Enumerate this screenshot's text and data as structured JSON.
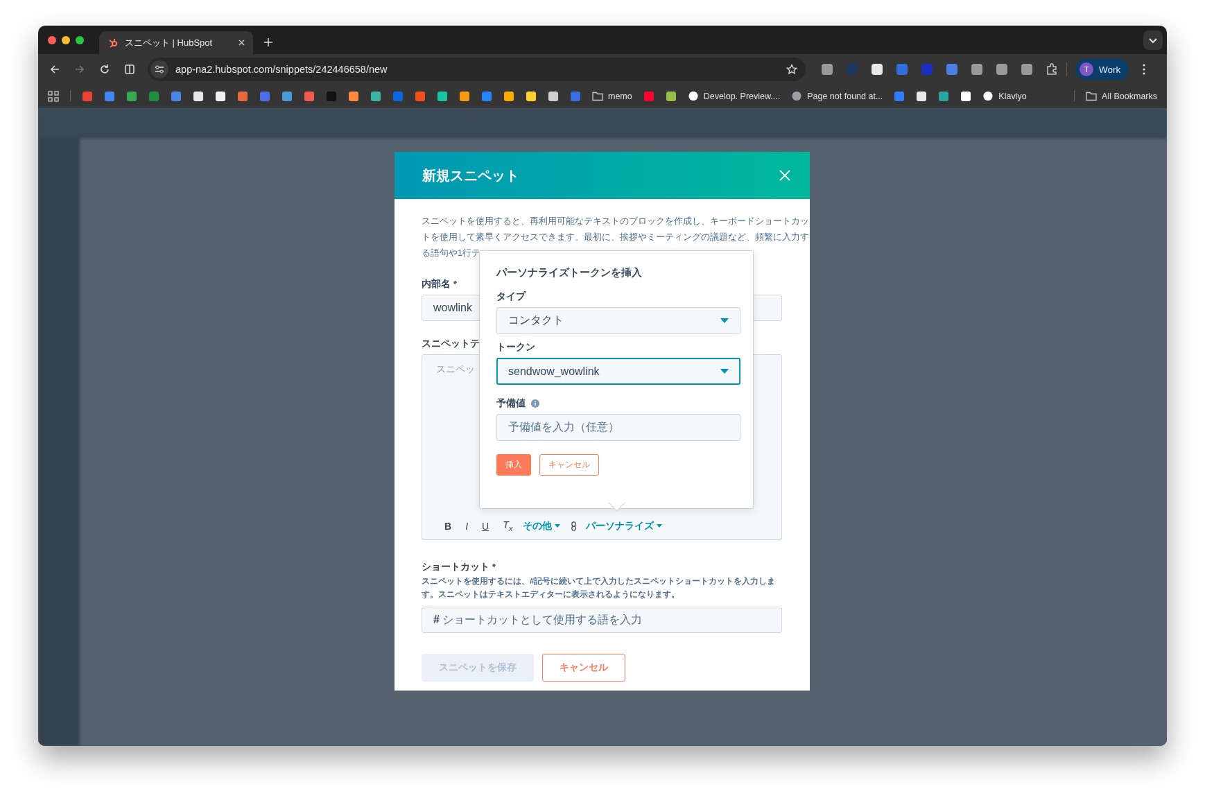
{
  "browser": {
    "tab": {
      "title": "スニペット | HubSpot",
      "selected": true
    },
    "address": "app-na2.hubspot.com/snippets/242446658/new",
    "extensions": [
      {
        "kind": "icon",
        "color": "#9a9a9a"
      },
      {
        "kind": "icon",
        "color": "#1e3a5f"
      },
      {
        "kind": "icon",
        "color": "#e8e8e8"
      },
      {
        "kind": "icon",
        "color": "#2f6fde"
      },
      {
        "kind": "icon",
        "color": "#1a2fbf"
      },
      {
        "kind": "icon",
        "color": "#4a7fe8"
      },
      {
        "kind": "icon",
        "color": "#9a9a9a"
      },
      {
        "kind": "icon",
        "color": "#9a9a9a"
      },
      {
        "kind": "icon",
        "color": "#9a9a9a"
      },
      {
        "kind": "puzzle"
      }
    ],
    "profile": {
      "initial": "T",
      "label": "Work"
    },
    "bookmarks": [
      {
        "kind": "icon",
        "color": "#ea4335"
      },
      {
        "kind": "icon",
        "color": "#4285f4"
      },
      {
        "kind": "icon",
        "color": "#34a853"
      },
      {
        "kind": "icon",
        "color": "#1e8e3e"
      },
      {
        "kind": "icon",
        "color": "#4a86e8"
      },
      {
        "kind": "icon",
        "color": "#e8e8e8"
      },
      {
        "kind": "icon",
        "color": "#f0f0f0"
      },
      {
        "kind": "icon",
        "color": "#e8693f"
      },
      {
        "kind": "icon",
        "color": "#4c6fe8"
      },
      {
        "kind": "icon",
        "color": "#4a9bd8"
      },
      {
        "kind": "icon",
        "color": "#ee5a4f"
      },
      {
        "kind": "icon",
        "color": "#111111"
      },
      {
        "kind": "icon",
        "color": "#ff8a3d"
      },
      {
        "kind": "icon",
        "color": "#3cb4a8"
      },
      {
        "kind": "icon",
        "color": "#0c66e4"
      },
      {
        "kind": "icon",
        "color": "#f24e1e"
      },
      {
        "kind": "icon",
        "color": "#19c3a5"
      },
      {
        "kind": "icon",
        "color": "#f39c12"
      },
      {
        "kind": "icon",
        "color": "#2684ff"
      },
      {
        "kind": "icon",
        "color": "#f9ab00"
      },
      {
        "kind": "icon",
        "color": "#ffd02f"
      },
      {
        "kind": "icon",
        "color": "#cfcfcf"
      },
      {
        "kind": "icon",
        "color": "#3b6fe0"
      },
      {
        "kind": "folder",
        "label": "memo"
      },
      {
        "kind": "icon",
        "color": "#ff0033"
      },
      {
        "kind": "icon",
        "color": "#95bf47"
      },
      {
        "kind": "site",
        "label": "Develop. Preview....",
        "color": "#ffffff"
      },
      {
        "kind": "site",
        "label": "Page not found at...",
        "color": "#9aa0a6"
      },
      {
        "kind": "icon",
        "color": "#2d7ff9"
      },
      {
        "kind": "icon",
        "color": "#e8e8e8"
      },
      {
        "kind": "icon",
        "color": "#2aa5a0"
      },
      {
        "kind": "icon",
        "color": "#ffffff"
      },
      {
        "kind": "site",
        "label": "Klaviyo",
        "color": "#ffffff"
      }
    ],
    "all_bookmarks": "All Bookmarks"
  },
  "modal": {
    "title": "新規スニペット",
    "description": [
      "スニペットを使用すると、再利用可能なテキストのブロックを作成し、キーボードショートカッ",
      "トを使用して素早くアクセスできます。最初に、挨拶やミーティングの議題など、頻繁に入力す",
      "る語句や1行テ"
    ],
    "name_field": {
      "label": "内部名 *",
      "value": "wowlink"
    },
    "body_field": {
      "label": "スニペットテ",
      "placeholder": "スニペッ",
      "toolbar": [
        {
          "kind": "bold",
          "label": "B"
        },
        {
          "kind": "italic",
          "label": "I"
        },
        {
          "kind": "underline",
          "label": "U"
        },
        {
          "kind": "clear",
          "label": "T$_{x}$"
        },
        {
          "kind": "menu",
          "label": "その他"
        },
        {
          "kind": "link"
        },
        {
          "kind": "menu",
          "label": "パーソナライズ"
        }
      ]
    },
    "shortcut_field": {
      "label": "ショートカット *",
      "help": "スニペットを使用するには、#記号に続いて上で入力したスニペットショートカットを入力します。スニペットはテキストエディターに表示されるようになります。",
      "prefix": "#",
      "placeholder": "ショートカットとして使用する語を入力"
    },
    "buttons": [
      {
        "kind": "primary",
        "label": "スニペットを保存",
        "disabled": true
      },
      {
        "kind": "secondary",
        "label": "キャンセル",
        "disabled": false
      }
    ]
  },
  "popup": {
    "title": "パーソナライズトークンを挿入",
    "fields": [
      {
        "kind": "select",
        "label": "タイプ",
        "value": "コンタクト",
        "focused": false
      },
      {
        "kind": "select",
        "label": "トークン",
        "value": "sendwow_wowlink",
        "focused": true
      },
      {
        "kind": "text",
        "label": "予備値",
        "info": true,
        "placeholder": "予備値を入力（任意）"
      }
    ],
    "buttons": [
      {
        "kind": "primary",
        "label": "挿入"
      },
      {
        "kind": "secondary",
        "label": "キャンセル"
      }
    ]
  }
}
